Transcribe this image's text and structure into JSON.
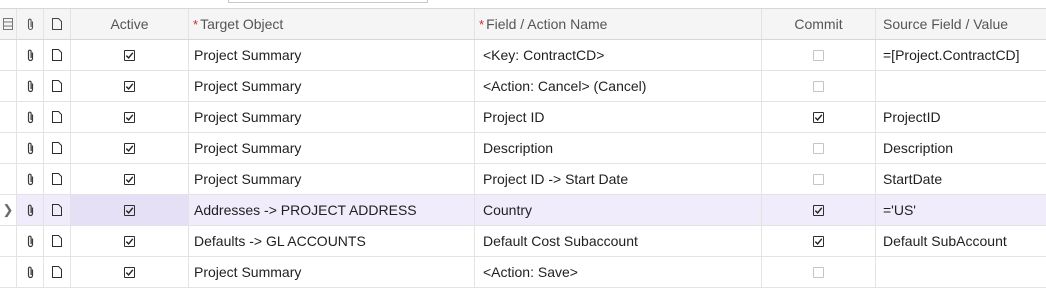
{
  "columns": {
    "active": "Active",
    "target": "Target Object",
    "field": "Field / Action Name",
    "commit": "Commit",
    "source": "Source Field / Value"
  },
  "rows": [
    {
      "active": true,
      "target": "Project Summary",
      "field": "<Key: ContractCD>",
      "commit": false,
      "source": "=[Project.ContractCD]"
    },
    {
      "active": true,
      "target": "Project Summary",
      "field": "<Action: Cancel> (Cancel)",
      "commit": false,
      "source": ""
    },
    {
      "active": true,
      "target": "Project Summary",
      "field": "Project ID",
      "commit": true,
      "source": "ProjectID"
    },
    {
      "active": true,
      "target": "Project Summary",
      "field": "Description",
      "commit": false,
      "source": "Description"
    },
    {
      "active": true,
      "target": "Project Summary",
      "field": "Project ID -> Start Date",
      "commit": false,
      "source": "StartDate"
    },
    {
      "active": true,
      "target": "Addresses -> PROJECT ADDRESS",
      "field": "Country",
      "commit": true,
      "source": "='US'",
      "current": true
    },
    {
      "active": true,
      "target": "Defaults -> GL ACCOUNTS",
      "field": "Default Cost Subaccount",
      "commit": true,
      "source": "Default SubAccount"
    },
    {
      "active": true,
      "target": "Project Summary",
      "field": "<Action: Save>",
      "commit": false,
      "source": ""
    }
  ]
}
